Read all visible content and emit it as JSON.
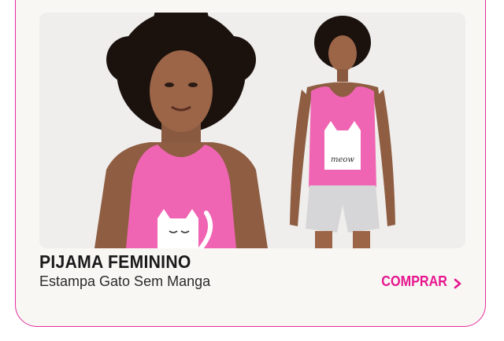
{
  "product": {
    "title": "PIJAMA FEMININO",
    "subtitle": "Estampa Gato Sem Manga",
    "cta_label": "COMPRAR",
    "print_text": "meow"
  },
  "icons": {
    "cta_icon": "chevron-right-icon"
  },
  "colors": {
    "accent": "#e6158d",
    "border": "#e62e9c",
    "card_bg": "#f8f7f4",
    "top_pink": "#f065b3"
  }
}
